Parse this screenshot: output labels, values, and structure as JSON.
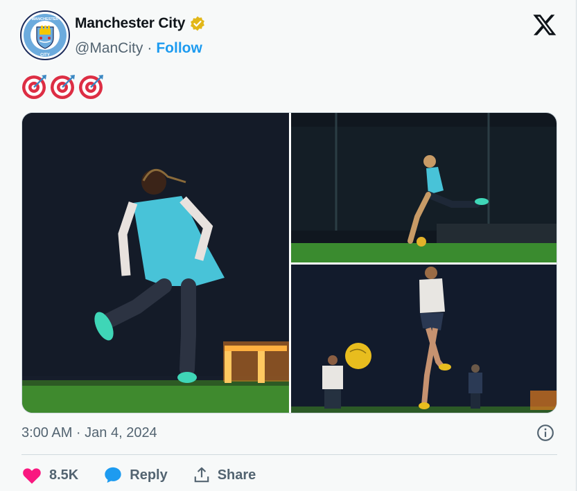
{
  "tweet": {
    "author_name": "Manchester City",
    "handle": "@ManCity",
    "separator": "·",
    "follow_label": "Follow",
    "text_emoji": [
      "🎯",
      "🎯",
      "🎯"
    ],
    "timestamp": "3:00 AM · Jan 4, 2024",
    "likes": "8.5K",
    "reply_label": "Reply",
    "share_label": "Share"
  },
  "colors": {
    "accent": "#1d9bf0",
    "like": "#f91880",
    "verified": "#e2b719",
    "muted": "#536471"
  },
  "icons": {
    "verified": "verified-badge-icon",
    "x_logo": "x-logo-icon",
    "info": "info-icon",
    "like": "heart-icon",
    "reply": "reply-bubble-icon",
    "share": "share-icon"
  },
  "crest_text": [
    "MANCHESTER",
    "CITY"
  ]
}
